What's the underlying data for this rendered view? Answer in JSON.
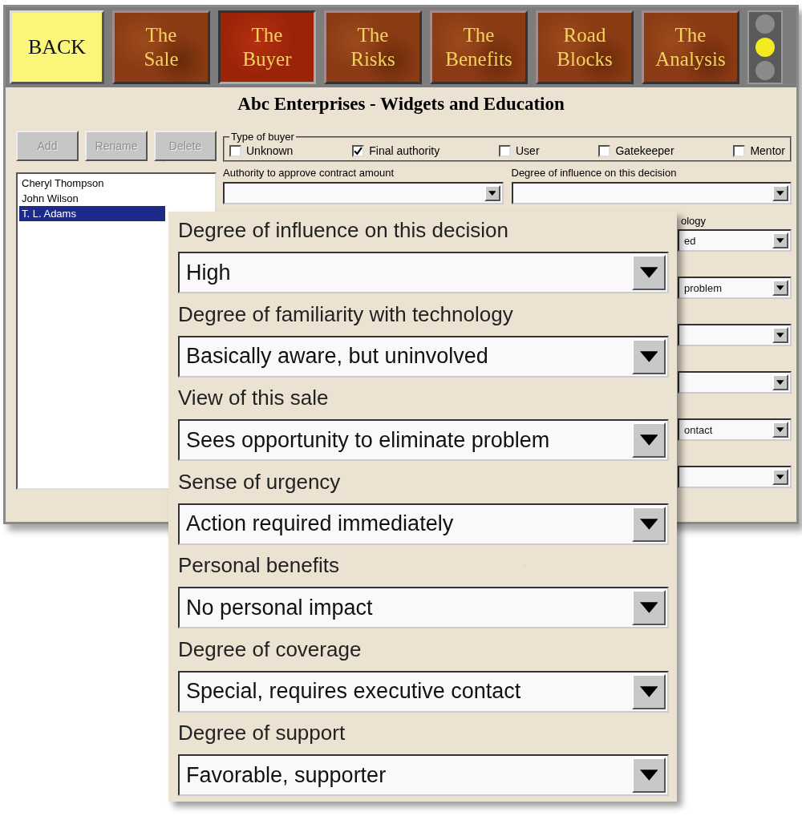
{
  "toolbar": {
    "back": "BACK",
    "tabs": [
      {
        "label": "The\nSale",
        "selected": false
      },
      {
        "label": "The\nBuyer",
        "selected": true
      },
      {
        "label": "The\nRisks",
        "selected": false
      },
      {
        "label": "The\nBenefits",
        "selected": false
      },
      {
        "label": "Road\nBlocks",
        "selected": false
      },
      {
        "label": "The\nAnalysis",
        "selected": false
      }
    ],
    "lights": [
      {
        "on": false
      },
      {
        "on": true
      },
      {
        "on": false
      }
    ]
  },
  "title": "Abc Enterprises - Widgets and Education",
  "buyer_buttons": [
    {
      "label": "Add",
      "disabled": true
    },
    {
      "label": "Rename",
      "disabled": true
    },
    {
      "label": "Delete",
      "disabled": true
    }
  ],
  "buyers": [
    {
      "name": "Cheryl Thompson",
      "selected": false
    },
    {
      "name": "John Wilson",
      "selected": false
    },
    {
      "name": "T. L. Adams",
      "selected": true
    }
  ],
  "type_of_buyer": {
    "legend": "Type of buyer",
    "options": [
      {
        "label": "Unknown",
        "checked": false
      },
      {
        "label": "Final authority",
        "checked": true
      },
      {
        "label": "User",
        "checked": false
      },
      {
        "label": "Gatekeeper",
        "checked": false
      },
      {
        "label": "Mentor",
        "checked": false
      }
    ]
  },
  "authority": {
    "label": "Authority to approve contract amount"
  },
  "influence": {
    "label": "Degree of influence on this decision"
  },
  "background_fields": [
    {
      "kind": "dropdown",
      "label": "ology",
      "value": "ed"
    },
    {
      "kind": "dropdown",
      "value": "problem"
    },
    {
      "kind": "dropdown"
    },
    {
      "kind": "dropdown"
    },
    {
      "kind": "dropdown",
      "value": "ontact"
    },
    {
      "kind": "dropdown"
    }
  ],
  "zoom_panel": [
    {
      "label": "Degree of influence on this decision",
      "value": "High"
    },
    {
      "label": "Degree of familiarity with technology",
      "value": "Basically aware, but uninvolved"
    },
    {
      "label": "View of this sale",
      "value": "Sees opportunity to eliminate problem"
    },
    {
      "label": "Sense of urgency",
      "value": "Action required immediately"
    },
    {
      "label": "Personal benefits",
      "value": "No personal impact"
    },
    {
      "label": "Degree of coverage",
      "value": "Special, requires executive contact"
    },
    {
      "label": "Degree of support",
      "value": "Favorable, supporter"
    }
  ]
}
